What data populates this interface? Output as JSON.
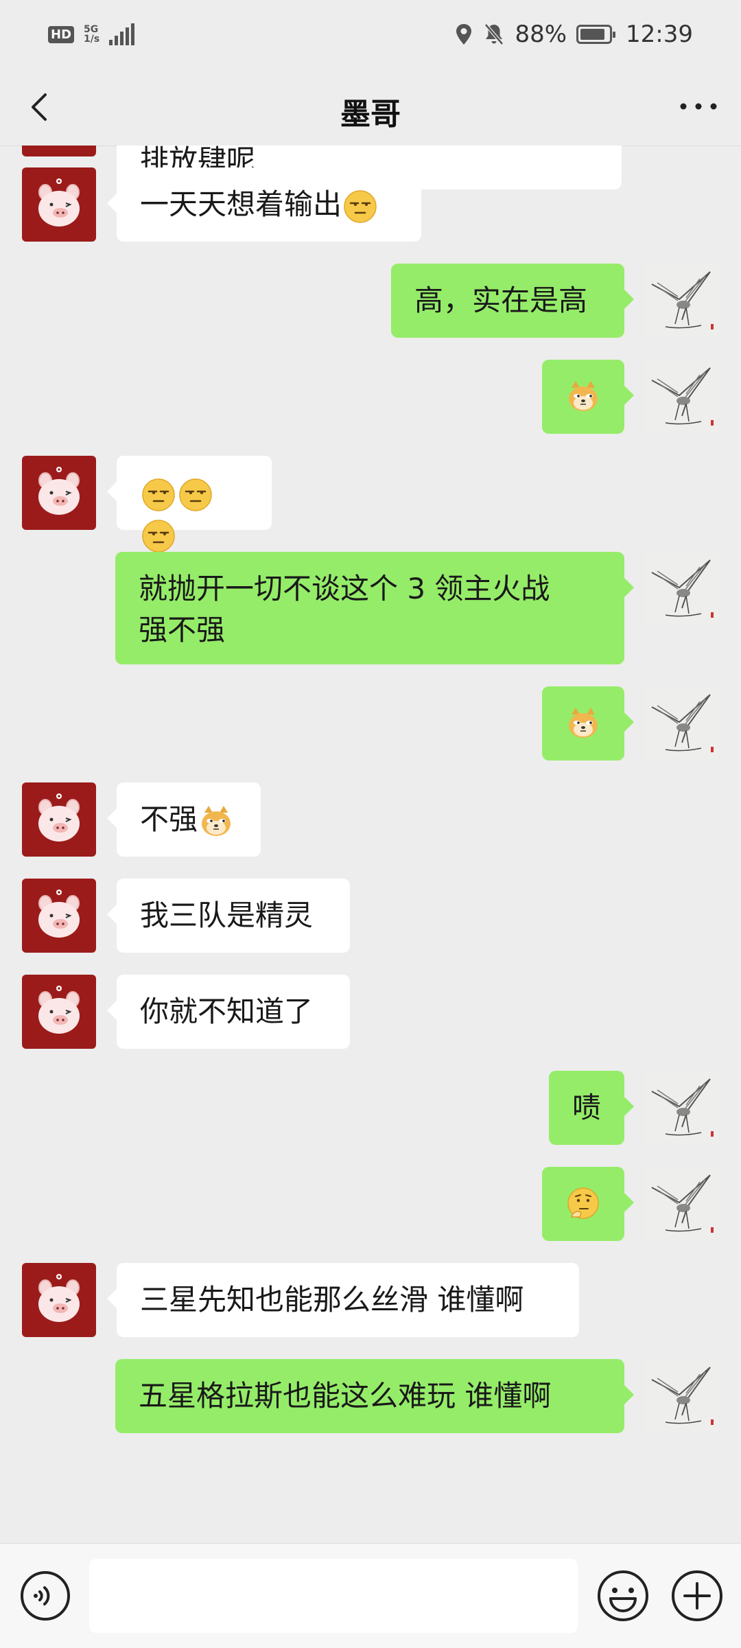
{
  "status_bar": {
    "hd": "HD",
    "network": "5G",
    "network_sub": "1/s",
    "battery": "88%",
    "battery_level": 0.88,
    "time": "12:39"
  },
  "header": {
    "title": "墨哥"
  },
  "messages": [
    {
      "from": "in",
      "text": "那是不是要游魂切死尼禄后 在后\n排放肆呢"
    },
    {
      "from": "in",
      "text": "一天天想着输出",
      "emoji": [
        "smirk-face"
      ]
    },
    {
      "from": "out",
      "text": "高，实在是高"
    },
    {
      "from": "out",
      "text": "",
      "emoji": [
        "doge-face"
      ]
    },
    {
      "from": "in",
      "text": "",
      "emoji": [
        "smirk-face",
        "smirk-face",
        "smirk-face"
      ]
    },
    {
      "from": "out",
      "text": "就抛开一切不谈这个 3 领主火战\n强不强"
    },
    {
      "from": "out",
      "text": "",
      "emoji": [
        "doge-face"
      ]
    },
    {
      "from": "in",
      "text": "不强",
      "emoji": [
        "doge-face"
      ]
    },
    {
      "from": "in",
      "text": "我三队是精灵"
    },
    {
      "from": "in",
      "text": "你就不知道了"
    },
    {
      "from": "out",
      "text": "啧"
    },
    {
      "from": "out",
      "text": "",
      "emoji": [
        "thinking-face"
      ]
    },
    {
      "from": "in",
      "text": "三星先知也能那么丝滑 谁懂啊"
    },
    {
      "from": "out",
      "text": "五星格拉斯也能这么难玩 谁懂啊"
    }
  ],
  "input": {
    "placeholder": ""
  },
  "colors": {
    "background": "#ededed",
    "bubble_out": "#95ec69",
    "bubble_in": "#ffffff",
    "avatar_bg": "#9b1b1b"
  },
  "icons": {
    "back": "chevron-left-icon",
    "more": "more-dots-icon",
    "voice": "voice-icon",
    "emoji": "emoji-icon",
    "plus": "plus-icon"
  }
}
